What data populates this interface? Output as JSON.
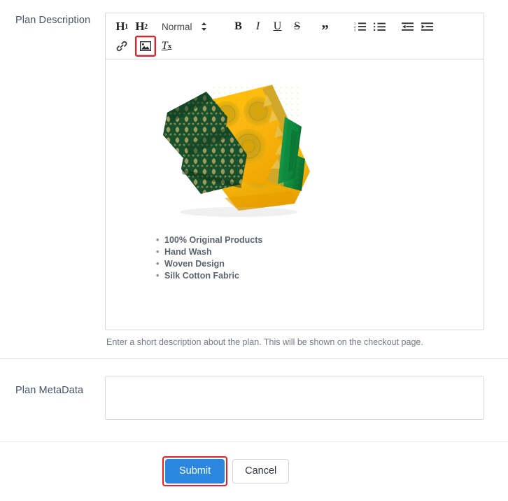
{
  "colors": {
    "accent_blue": "#2a86de",
    "highlight_red": "#ee1c24",
    "label_text": "#45546b",
    "help_text": "#737b88",
    "border": "#d7d9dc",
    "divider": "#e6e8ea"
  },
  "description_field": {
    "label": "Plan Description",
    "help_text": "Enter a short description about the plan. This will be shown on the checkout page.",
    "toolbar": {
      "h1_label": "H",
      "h1_sub": "1",
      "h2_label": "H",
      "h2_sub": "2",
      "format_picker_value": "Normal",
      "bold_label": "B",
      "italic_label": "I",
      "underline_label": "U",
      "strike_label": "S",
      "quote_label": "”",
      "clear_label": "T",
      "clear_sub": "x",
      "items": [
        {
          "name": "heading-1",
          "title": "Heading 1"
        },
        {
          "name": "heading-2",
          "title": "Heading 2"
        },
        {
          "name": "format-picker",
          "title": "Normal"
        },
        {
          "name": "bold",
          "title": "Bold"
        },
        {
          "name": "italic",
          "title": "Italic"
        },
        {
          "name": "underline",
          "title": "Underline"
        },
        {
          "name": "strikethrough",
          "title": "Strikethrough"
        },
        {
          "name": "blockquote",
          "title": "Blockquote"
        },
        {
          "name": "ordered-list",
          "title": "Ordered list"
        },
        {
          "name": "bullet-list",
          "title": "Bullet list"
        },
        {
          "name": "outdent",
          "title": "Decrease indent"
        },
        {
          "name": "indent",
          "title": "Increase indent"
        },
        {
          "name": "link",
          "title": "Insert link"
        },
        {
          "name": "image",
          "title": "Insert image"
        },
        {
          "name": "clear-formatting",
          "title": "Clear formatting"
        }
      ]
    },
    "content": {
      "image_alt": "Yellow silk cotton saree with green and gold brocade border, folded",
      "bullets": [
        "100% Original Products",
        "Hand Wash",
        "Woven Design",
        "Silk Cotton Fabric"
      ]
    }
  },
  "metadata_field": {
    "label": "Plan MetaData",
    "value": "",
    "placeholder": ""
  },
  "actions": {
    "submit_label": "Submit",
    "cancel_label": "Cancel"
  }
}
